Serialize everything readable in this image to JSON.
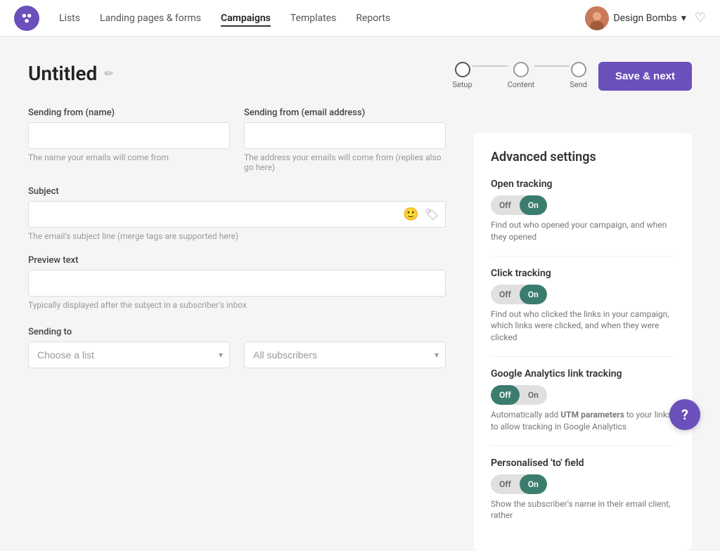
{
  "nav": {
    "links": [
      {
        "label": "Lists",
        "active": false
      },
      {
        "label": "Landing pages & forms",
        "active": false
      },
      {
        "label": "Campaigns",
        "active": true
      },
      {
        "label": "Templates",
        "active": false
      },
      {
        "label": "Reports",
        "active": false
      }
    ],
    "user_name": "Design Bombs",
    "heart_label": "♡"
  },
  "page": {
    "title": "Untitled",
    "edit_icon": "✏"
  },
  "steps": [
    {
      "label": "Setup",
      "state": "active"
    },
    {
      "label": "Content",
      "state": "default"
    },
    {
      "label": "Send",
      "state": "default"
    }
  ],
  "save_next_label": "Save & next",
  "form": {
    "sending_from_name_label": "Sending from (name)",
    "sending_from_name_placeholder": "",
    "sending_from_name_hint": "The name your emails will come from",
    "sending_from_email_label": "Sending from (email address)",
    "sending_from_email_placeholder": "",
    "sending_from_email_hint": "The address your emails will come from (replies also go here)",
    "subject_label": "Subject",
    "subject_placeholder": "",
    "subject_hint": "The email's subject line (merge tags are supported here)",
    "preview_text_label": "Preview text",
    "preview_text_placeholder": "",
    "preview_text_hint": "Typically displayed after the subject in a subscriber's inbox",
    "sending_to_label": "Sending to",
    "choose_list_placeholder": "Choose a list",
    "all_subscribers_placeholder": "All subscribers"
  },
  "advanced": {
    "title": "Advanced settings",
    "settings": [
      {
        "id": "open-tracking",
        "label": "Open tracking",
        "state": "on",
        "hint": "Find out who opened your campaign, and when they opened"
      },
      {
        "id": "click-tracking",
        "label": "Click tracking",
        "state": "on",
        "hint": "Find out who clicked the links in your campaign, which links were clicked, and when they were clicked"
      },
      {
        "id": "ga-tracking",
        "label": "Google Analytics link tracking",
        "state": "off",
        "hint": "Automatically add UTM parameters to your links to allow tracking in Google Analytics",
        "hint_bold": "UTM parameters"
      },
      {
        "id": "personalised-to",
        "label": "Personalised 'to' field",
        "state": "on",
        "hint": "Show the subscriber's name in their email client, rather"
      }
    ]
  },
  "help_btn_label": "?"
}
